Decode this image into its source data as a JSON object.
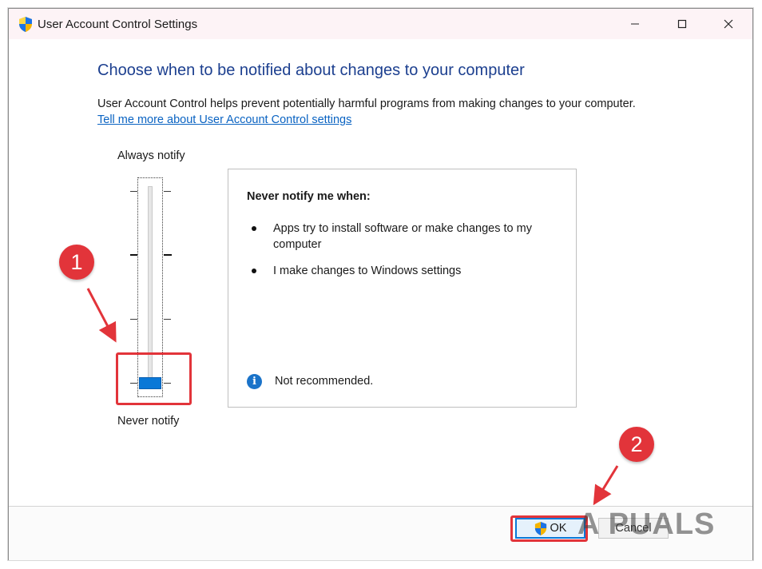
{
  "window": {
    "title": "User Account Control Settings",
    "icon": "uac-shield-icon",
    "controls": {
      "minimize_icon": "minimize-icon",
      "maximize_icon": "maximize-icon",
      "close_icon": "close-icon"
    }
  },
  "main": {
    "heading": "Choose when to be notified about changes to your computer",
    "description": "User Account Control helps prevent potentially harmful programs from making changes to your computer.",
    "link": "Tell me more about User Account Control settings"
  },
  "slider": {
    "top_label": "Always notify",
    "bottom_label": "Never notify",
    "levels": 4,
    "selected_level": 1
  },
  "info_box": {
    "heading": "Never notify me when:",
    "bullets": [
      "Apps try to install software or make changes to my computer",
      "I make changes to Windows settings"
    ],
    "note": "Not recommended.",
    "note_icon": "info-icon"
  },
  "buttons": {
    "ok": "OK",
    "cancel": "Cancel"
  },
  "annotations": {
    "step1": "1",
    "step2": "2",
    "color": "#e2343a"
  },
  "watermark": "A  PUALS",
  "colors": {
    "heading": "#1c3f8f",
    "link": "#0a63c2",
    "slider_thumb": "#0a78d7",
    "titlebar": "#fdf3f6"
  }
}
